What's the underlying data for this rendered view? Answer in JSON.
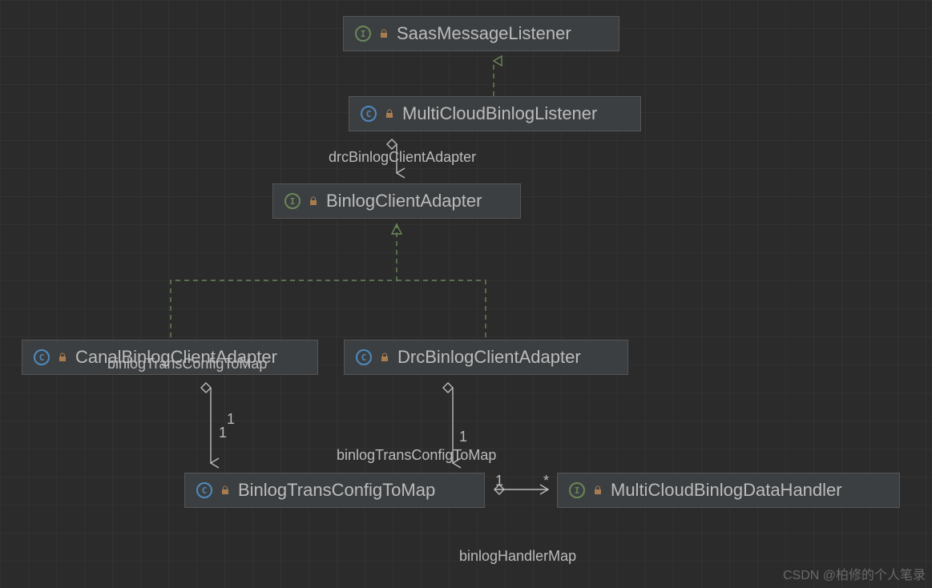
{
  "nodes": {
    "saasMessageListener": {
      "name": "SaasMessageListener",
      "type": "interface"
    },
    "multiCloudBinlogListener": {
      "name": "MultiCloudBinlogListener",
      "type": "class"
    },
    "binlogClientAdapter": {
      "name": "BinlogClientAdapter",
      "type": "interface"
    },
    "canalBinlogClientAdapter": {
      "name": "CanalBinlogClientAdapter",
      "type": "class"
    },
    "drcBinlogClientAdapter": {
      "name": "DrcBinlogClientAdapter",
      "type": "class"
    },
    "binlogTransConfigToMap": {
      "name": "BinlogTransConfigToMap",
      "type": "class"
    },
    "multiCloudBinlogDataHandler": {
      "name": "MultiCloudBinlogDataHandler",
      "type": "interface"
    }
  },
  "edgeLabels": {
    "drcBinlogClientAdapterLabel": "drcBinlogClientAdapter",
    "binlogTransConfigToMapTop": "binlogTransConfigToMap",
    "binlogTransConfigToMapMid": "binlogTransConfigToMap",
    "binlogHandlerMap": "binlogHandlerMap"
  },
  "multiplicities": {
    "one_a": "1",
    "one_b": "1",
    "one_c": "1",
    "one_d": "1",
    "star": "*"
  },
  "watermark": "CSDN @柏修的个人笔录",
  "colors": {
    "bg": "#2b2b2b",
    "boxBg": "#3c3f41",
    "border": "#555555",
    "text": "#bbbbbb",
    "dashedLine": "#6a8759",
    "solidLine": "#bbbbbb",
    "interfaceIcon": "#6a8759",
    "classIcon": "#4e8abf",
    "lock": "#a97c50"
  }
}
